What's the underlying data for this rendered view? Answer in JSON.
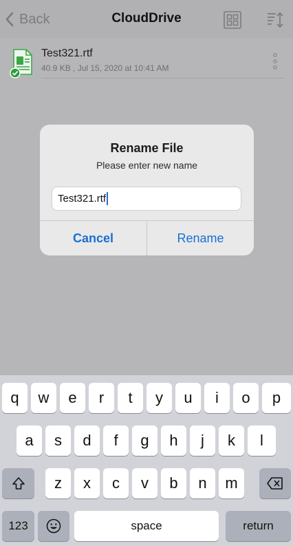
{
  "nav": {
    "back_label": "Back",
    "title": "CloudDrive"
  },
  "file": {
    "name": "Test321.rtf",
    "meta": "40.9 KB , Jul 15, 2020 at 10:41 AM"
  },
  "dialog": {
    "title": "Rename File",
    "message": "Please enter new name",
    "input_value": "Test321.rtf",
    "cancel_label": "Cancel",
    "rename_label": "Rename"
  },
  "keyboard": {
    "row1": [
      "q",
      "w",
      "e",
      "r",
      "t",
      "y",
      "u",
      "i",
      "o",
      "p"
    ],
    "row2": [
      "a",
      "s",
      "d",
      "f",
      "g",
      "h",
      "j",
      "k",
      "l"
    ],
    "row3": [
      "z",
      "x",
      "c",
      "v",
      "b",
      "n",
      "m"
    ],
    "numbers_label": "123",
    "space_label": "space",
    "return_label": "return"
  },
  "colors": {
    "accent": "#1a6fd0",
    "file_green": "#3aa845",
    "keyboard_bg": "#d1d3d9"
  },
  "icons": {
    "back": "chevron-left-icon",
    "grid": "grid-view-icon",
    "sort": "sort-icon",
    "file": "document-icon",
    "status": "checkmark-badge-icon",
    "more": "more-vertical-icon",
    "shift": "shift-icon",
    "delete": "delete-backspace-icon",
    "emoji": "emoji-icon"
  }
}
